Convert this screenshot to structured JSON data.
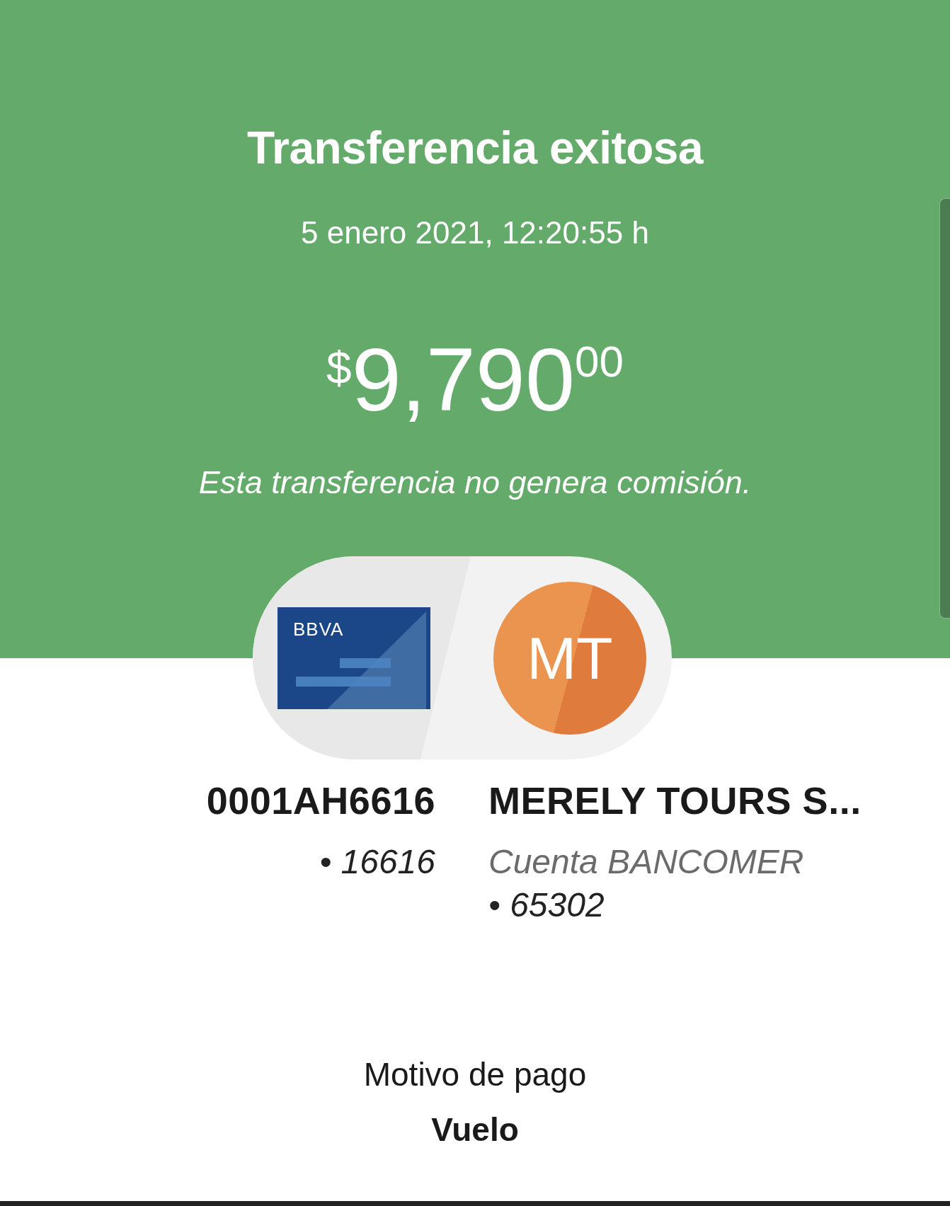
{
  "header": {
    "title": "Transferencia exitosa",
    "datetime": "5 enero 2021, 12:20:55 h",
    "amount": {
      "currency": "$",
      "whole": "9,790",
      "cents": "00"
    },
    "note": "Esta transferencia no genera comisión."
  },
  "origin": {
    "card_brand": "BBVA",
    "name": "0001AH6616",
    "account": "• 16616"
  },
  "destination": {
    "initials": "MT",
    "name": "MERELY TOURS S...",
    "bank": "Cuenta BANCOMER",
    "account": "• 65302"
  },
  "details": {
    "label": "Motivo de pago",
    "value": "Vuelo"
  }
}
